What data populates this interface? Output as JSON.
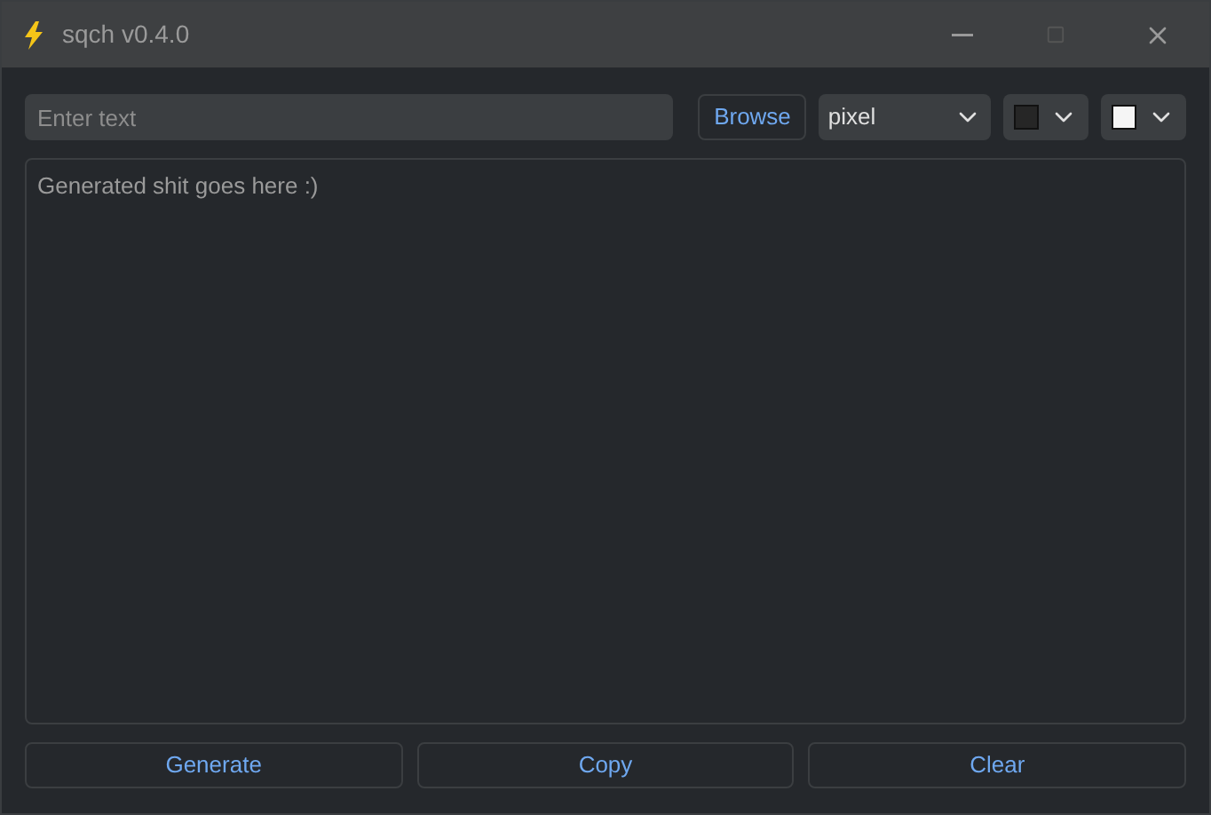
{
  "window": {
    "title": "sqch v0.4.0"
  },
  "input": {
    "placeholder": "Enter text"
  },
  "browse_button": "Browse",
  "font_select": {
    "value": "pixel"
  },
  "color_pickers": [
    {
      "color": "#262626"
    },
    {
      "color": "#f5f5f5"
    }
  ],
  "output": {
    "placeholder": "Generated shit goes here :)"
  },
  "buttons": [
    "Generate",
    "Copy",
    "Clear"
  ]
}
